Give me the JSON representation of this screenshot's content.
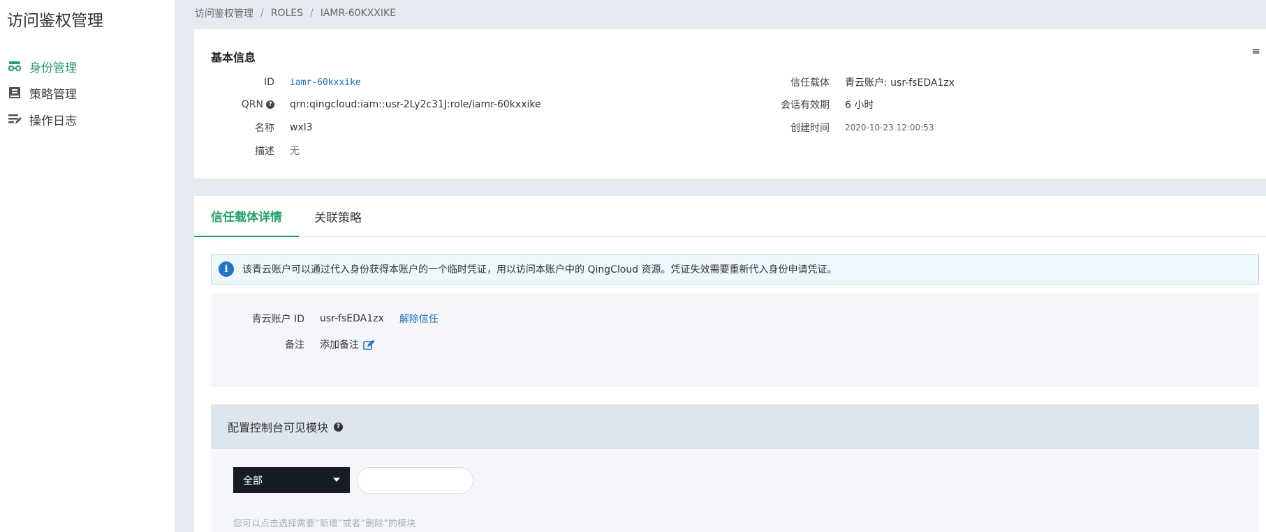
{
  "sidebar": {
    "title": "访问鉴权管理",
    "items": [
      {
        "label": "身份管理",
        "icon": "identity-icon",
        "active": true
      },
      {
        "label": "策略管理",
        "icon": "policy-icon",
        "active": false
      },
      {
        "label": "操作日志",
        "icon": "log-icon",
        "active": false
      }
    ]
  },
  "breadcrumb": [
    "访问鉴权管理",
    "ROLES",
    "IAMR-60KXXIKE"
  ],
  "basic": {
    "title": "基本信息",
    "id_label": "ID",
    "id_value": "iamr-60kxxike",
    "qrn_label": "QRN",
    "qrn_help": "?",
    "qrn_value": "qrn:qingcloud:iam::usr-2Ly2c31J:role/iamr-60kxxike",
    "name_label": "名称",
    "name_value": "wxl3",
    "desc_label": "描述",
    "desc_value": "无",
    "trust_label": "信任载体",
    "trust_value": "青云账户: usr-fsEDA1zx",
    "session_label": "会话有效期",
    "session_value": "6 小时",
    "created_label": "创建时间",
    "created_value": "2020-10-23 12:00:53"
  },
  "tabs": [
    {
      "label": "信任载体详情",
      "active": true
    },
    {
      "label": "关联策略",
      "active": false
    }
  ],
  "info": {
    "icon": "info-icon",
    "text": "该青云账户可以通过代入身份获得本账户的一个临时凭证，用以访问本账户中的 QingCloud 资源。凭证失效需要重新代入身份申请凭证。"
  },
  "trust": {
    "account_label": "青云账户 ID",
    "account_value": "usr-fsEDA1zx",
    "remove_link": "解除信任",
    "note_label": "备注",
    "note_add": "添加备注"
  },
  "module": {
    "title": "配置控制台可见模块",
    "help": "?",
    "filter_selected": "全部",
    "search_placeholder": "",
    "hint": "您可以点击选择需要“新增”或者“删除”的模块"
  },
  "colors": {
    "accent": "#22a06b",
    "link": "#1f6fb5",
    "dark": "#151c24"
  }
}
